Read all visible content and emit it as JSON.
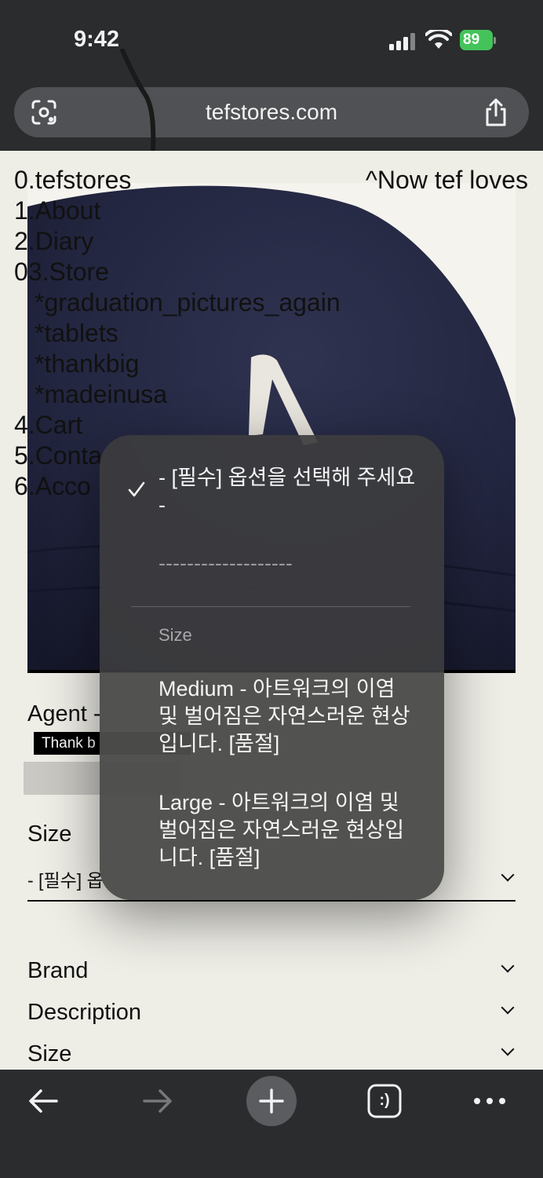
{
  "status_bar": {
    "time": "9:42",
    "battery": "89"
  },
  "browser": {
    "url": "tefstores.com"
  },
  "nav": {
    "items": [
      "0.tefstores",
      "1.About",
      "2.Diary",
      "03.Store"
    ],
    "sub_items": [
      "*graduation_pictures_again",
      "*tablets",
      "*thankbig",
      "*madeinusa"
    ],
    "more_items": [
      "4.Cart",
      "5.Conta",
      "6.Acco"
    ]
  },
  "tagline": "^Now tef loves",
  "product": {
    "title": "Agent -",
    "badge": "Thank b",
    "size_label": "Size",
    "size_select_value": "- [필수] 옵"
  },
  "accordions": [
    "Brand",
    "Description",
    "Size"
  ],
  "dropdown": {
    "options": [
      {
        "label": "- [필수] 옵션을 선택해 주세요 -",
        "selected": true
      },
      {
        "label": "-------------------",
        "selected": false
      }
    ],
    "group_label": "Size",
    "group_options": [
      "Medium - 아트워크의 이염 및 벌어짐은 자연스러운 현상입니다. [품절]",
      "Large - 아트워크의 이염 및 벌어짐은 자연스러운 현상입니다. [품절]"
    ]
  },
  "toolbar": {
    "tabs_face": ":)"
  },
  "colors": {
    "chrome": "#2b2c2e",
    "battery": "#44c35a",
    "page_bg": "#eeede6",
    "cap": "#1f2236"
  }
}
